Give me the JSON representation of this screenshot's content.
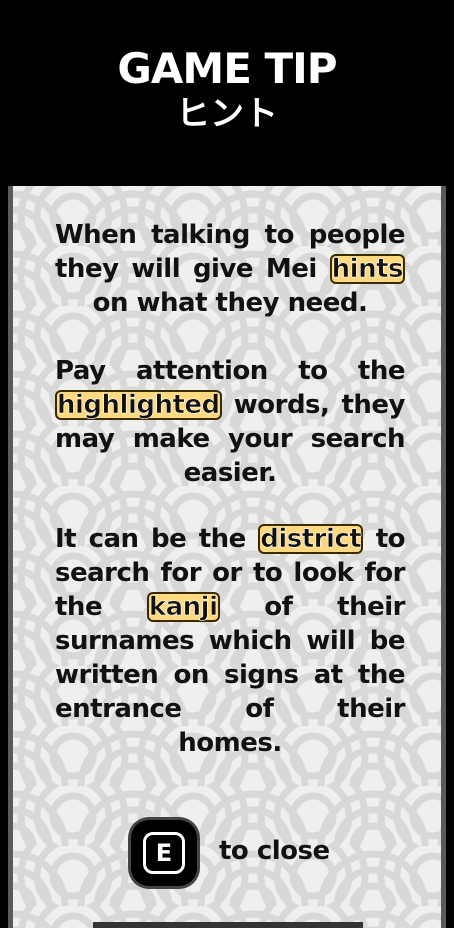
{
  "header": {
    "title": "GAME TIP",
    "subtitle": "ヒント"
  },
  "tip": {
    "p1": {
      "before": "When talking to people they will give Mei ",
      "highlight": "hints",
      "after": " on what they need."
    },
    "p2": {
      "before": "Pay attention to the ",
      "highlight": "highlighted",
      "after": " words, they may make your search easier."
    },
    "p3": {
      "before": "It can be the ",
      "highlight1": "district",
      "middle": " to search for or to look for the ",
      "highlight2": "kanji",
      "after": " of their surnames which will be written on signs at the entrance of their homes."
    }
  },
  "close_hint": {
    "key": "E",
    "label": "to close"
  },
  "colors": {
    "highlight": "#ffd980",
    "panel": "#efefef",
    "header": "#000000"
  }
}
